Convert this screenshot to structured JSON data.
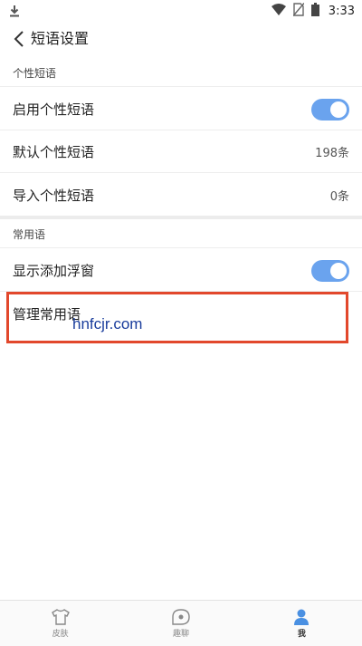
{
  "status_bar": {
    "time": "3:33",
    "icons": [
      "download-icon",
      "wifi-icon",
      "no-sim-icon",
      "battery-icon"
    ]
  },
  "header": {
    "title": "短语设置",
    "back_icon": "chevron-left-icon"
  },
  "sections": [
    {
      "title": "个性短语",
      "rows": [
        {
          "label": "启用个性短语",
          "control": "toggle",
          "toggle_on": true
        },
        {
          "label": "默认个性短语",
          "value": "198条"
        },
        {
          "label": "导入个性短语",
          "value": "0条"
        }
      ]
    },
    {
      "title": "常用语",
      "rows": [
        {
          "label": "显示添加浮窗",
          "control": "toggle",
          "toggle_on": true
        },
        {
          "label": "管理常用语"
        }
      ]
    }
  ],
  "watermark": "hnfcjr.com",
  "bottom_nav": [
    {
      "label": "皮肤",
      "icon": "shirt-icon",
      "active": false
    },
    {
      "label": "趣聊",
      "icon": "chat-bubble-icon",
      "active": false
    },
    {
      "label": "我",
      "icon": "user-icon",
      "active": true
    }
  ],
  "colors": {
    "toggle_on": "#6aa3ee",
    "highlight_border": "#e2482c",
    "watermark": "#1a3d9c"
  }
}
